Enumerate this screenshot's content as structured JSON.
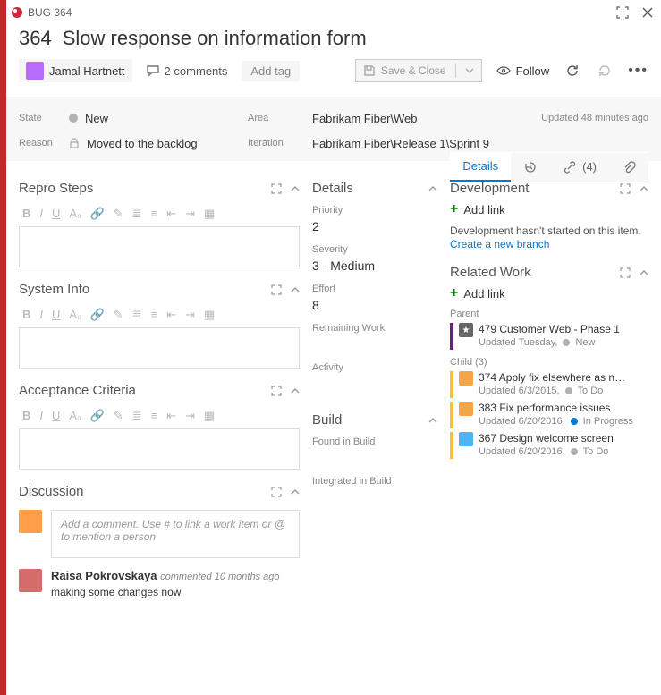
{
  "titlebar": {
    "label": "BUG 364"
  },
  "header": {
    "id": "364",
    "title": "Slow response on information form"
  },
  "toolbar": {
    "assignee": "Jamal Hartnett",
    "comments": "2 comments",
    "addTag": "Add tag",
    "saveClose": "Save & Close",
    "follow": "Follow"
  },
  "meta": {
    "stateLabel": "State",
    "state": "New",
    "areaLabel": "Area",
    "area": "Fabrikam Fiber\\Web",
    "updated": "Updated 48 minutes ago",
    "reasonLabel": "Reason",
    "reason": "Moved to the backlog",
    "iterLabel": "Iteration",
    "iteration": "Fabrikam Fiber\\Release 1\\Sprint 9"
  },
  "tabs": {
    "details": "Details",
    "linksCount": "(4)"
  },
  "sections": {
    "repro": "Repro Steps",
    "sysinfo": "System Info",
    "acceptance": "Acceptance Criteria",
    "discussion": "Discussion",
    "detailsMid": "Details",
    "build": "Build",
    "development": "Development",
    "relatedWork": "Related Work"
  },
  "detailsFields": {
    "priorityLabel": "Priority",
    "priority": "2",
    "severityLabel": "Severity",
    "severity": "3 - Medium",
    "effortLabel": "Effort",
    "effort": "8",
    "remainingLabel": "Remaining Work",
    "activityLabel": "Activity"
  },
  "buildFields": {
    "foundLabel": "Found in Build",
    "integratedLabel": "Integrated in Build"
  },
  "development": {
    "addLink": "Add link",
    "notStarted": "Development hasn't started on this item.",
    "newBranch": "Create a new branch"
  },
  "related": {
    "addLink": "Add link",
    "parentLabel": "Parent",
    "childLabel": "Child (3)",
    "parent": {
      "id": "479",
      "title": "Customer Web - Phase 1",
      "meta": "Updated Tuesday,",
      "state": "New"
    },
    "children": [
      {
        "id": "374",
        "title": "Apply fix elsewhere as n…",
        "meta": "Updated 6/3/2015,",
        "state": "To Do",
        "stateDot": "g"
      },
      {
        "id": "383",
        "title": "Fix performance issues",
        "meta": "Updated 6/20/2016,",
        "state": "In Progress",
        "stateDot": "b"
      },
      {
        "id": "367",
        "title": "Design welcome screen",
        "meta": "Updated 6/20/2016,",
        "state": "To Do",
        "stateDot": "g"
      }
    ]
  },
  "discussion": {
    "placeholder": "Add a comment. Use # to link a work item or @ to mention a person",
    "comments": [
      {
        "author": "Raisa Pokrovskaya",
        "action": "commented",
        "when": "10 months ago",
        "body": "making some changes now"
      }
    ]
  }
}
